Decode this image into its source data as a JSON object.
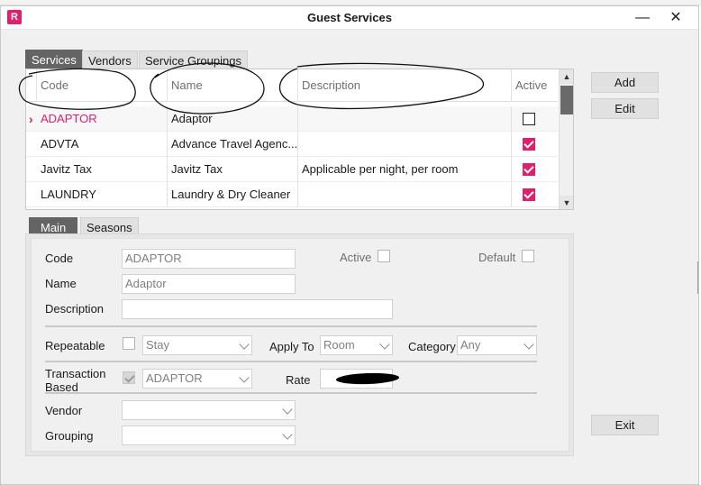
{
  "window": {
    "title": "Guest Services",
    "logo_letter": "R",
    "minimize_glyph": "—",
    "close_glyph": "✕"
  },
  "top_tabs": [
    {
      "label": "Services",
      "active": true
    },
    {
      "label": "Vendors",
      "active": false
    },
    {
      "label": "Service Groupings",
      "active": false
    }
  ],
  "grid": {
    "columns": [
      "Code",
      "Name",
      "Description",
      "Active"
    ],
    "rows": [
      {
        "code": "ADAPTOR",
        "name": "Adaptor",
        "description": "",
        "active": false,
        "selected": true
      },
      {
        "code": "ADVTA",
        "name": "Advance Travel Agenc...",
        "description": "",
        "active": true,
        "selected": false
      },
      {
        "code": "Javitz Tax",
        "name": "Javitz Tax",
        "description": "Applicable per night, per room",
        "active": true,
        "selected": false
      },
      {
        "code": "LAUNDRY",
        "name": "Laundry & Dry Cleaner",
        "description": "",
        "active": true,
        "selected": false
      }
    ]
  },
  "buttons": {
    "add": "Add",
    "edit": "Edit",
    "exit": "Exit"
  },
  "detail_tabs": [
    {
      "label": "Main",
      "active": true
    },
    {
      "label": "Seasons",
      "active": false
    }
  ],
  "detail": {
    "code_label": "Code",
    "code_value": "ADAPTOR",
    "active_label": "Active",
    "default_label": "Default",
    "name_label": "Name",
    "name_value": "Adaptor",
    "description_label": "Description",
    "description_value": "",
    "repeatable_label": "Repeatable",
    "repeatable_select": "Stay",
    "apply_to_label": "Apply To",
    "apply_to_value": "Room",
    "category_label": "Category",
    "category_value": "Any",
    "transaction_label_1": "Transaction",
    "transaction_label_2": "Based",
    "transaction_select": "ADAPTOR",
    "rate_label": "Rate",
    "vendor_label": "Vendor",
    "vendor_value": "",
    "grouping_label": "Grouping",
    "grouping_value": ""
  },
  "colors": {
    "accent": "#e0206a",
    "tab_active": "#646464"
  }
}
